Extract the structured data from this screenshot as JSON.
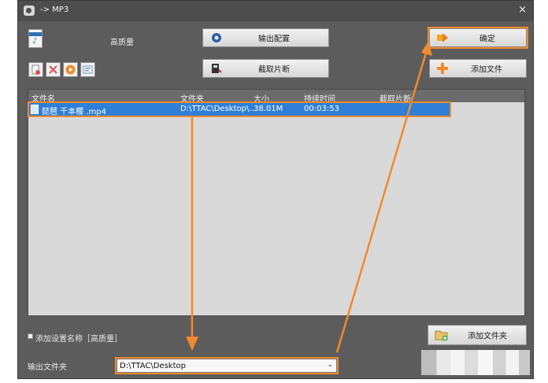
{
  "window": {
    "title": "-> MP3",
    "close_glyph": "×"
  },
  "profile": {
    "quality_label": "高质量",
    "mp3_icon_text": "♪"
  },
  "toolbar": {
    "output_config_label": "输出配置",
    "clip_label": "截取片断",
    "ok_label": "确定",
    "add_file_label": "添加文件",
    "add_folder_label": "添加文件夹"
  },
  "list": {
    "columns": [
      "文件名",
      "文件夹",
      "大小",
      "持续时间",
      "截取片断"
    ],
    "rows": [
      {
        "name": "琵琶 千本樱 .mp4",
        "folder": "D:\\TTAC\\Desktop\\...",
        "size": "38.01M",
        "duration": "00:03:53",
        "clip": ""
      }
    ]
  },
  "options": {
    "add_setting_name_label": "添加设置名称［高质量］"
  },
  "output": {
    "label": "输出文件夹",
    "folder_value": "D:\\TTAC\\Desktop",
    "dropdown_glyph": "⌄"
  },
  "colors": {
    "annotation": "#f08a2c",
    "selection": "#2f7fd8",
    "window_bg": "#5c5c5c"
  }
}
